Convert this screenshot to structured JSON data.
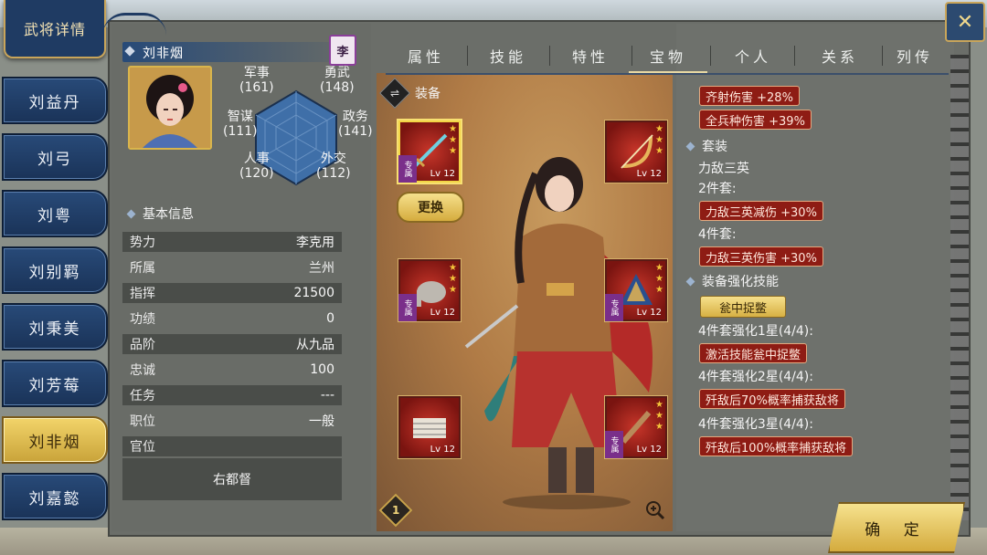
{
  "title": "武将详情",
  "characters": [
    "刘益丹",
    "刘弓",
    "刘粤",
    "刘别羁",
    "刘秉美",
    "刘芳莓",
    "刘非烟",
    "刘嘉懿"
  ],
  "active_character_index": 6,
  "profile": {
    "name": "刘非烟",
    "faction_badge": "李",
    "stats": [
      {
        "label": "军事",
        "value": "(161)"
      },
      {
        "label": "勇武",
        "value": "(148)"
      },
      {
        "label": "智谋",
        "value": "(111)"
      },
      {
        "label": "政务",
        "value": "(141)"
      },
      {
        "label": "人事",
        "value": "(120)"
      },
      {
        "label": "外交",
        "value": "(112)"
      }
    ]
  },
  "basic_info": {
    "header": "基本信息",
    "rows": [
      {
        "k": "势力",
        "v": "李克用"
      },
      {
        "k": "所属",
        "v": "兰州"
      },
      {
        "k": "指挥",
        "v": "21500"
      },
      {
        "k": "功绩",
        "v": "0"
      },
      {
        "k": "品阶",
        "v": "从九品"
      },
      {
        "k": "忠诚",
        "v": "100"
      },
      {
        "k": "任务",
        "v": "---"
      },
      {
        "k": "职位",
        "v": "一般"
      },
      {
        "k": "官位",
        "v": ""
      }
    ],
    "official_title": "右都督"
  },
  "tabs": [
    "属性",
    "技能",
    "特性",
    "宝物",
    "个人",
    "关系",
    "列传"
  ],
  "active_tab_index": 3,
  "equipment": {
    "header": "装备",
    "replace_label": "更换",
    "count": "1",
    "slots": [
      {
        "name": "sword",
        "lv": "Lv 12",
        "stars": 3,
        "exclusive_label": "专属",
        "selected": true
      },
      {
        "name": "bow",
        "lv": "Lv 12",
        "stars": 3,
        "exclusive_label": "",
        "selected": false
      },
      {
        "name": "elephant",
        "lv": "Lv 12",
        "stars": 3,
        "exclusive_label": "专属",
        "selected": false
      },
      {
        "name": "cloak",
        "lv": "Lv 12",
        "stars": 3,
        "exclusive_label": "专属",
        "selected": false
      },
      {
        "name": "book",
        "lv": "Lv 12",
        "stars": 0,
        "exclusive_label": "",
        "selected": false
      },
      {
        "name": "pipe",
        "lv": "Lv 12",
        "stars": 3,
        "exclusive_label": "专属",
        "selected": false
      }
    ]
  },
  "effects": {
    "bonuses": [
      "齐射伤害 +28%",
      "全兵种伤害 +39%"
    ],
    "set_header": "套装",
    "set_name": "力敌三英",
    "set2_label": "2件套:",
    "set2_bonus": "力敌三英减伤 +30%",
    "set4_label": "4件套:",
    "set4_bonus": "力敌三英伤害 +30%",
    "enhance_header": "装备强化技能",
    "enhance_skill": "瓮中捉鳖",
    "star1_label": "4件套强化1星(4/4):",
    "star1_bonus": "激活技能瓮中捉鳖",
    "star2_label": "4件套强化2星(4/4):",
    "star2_bonus": "歼敌后70%概率捕获敌将",
    "star3_label": "4件套强化3星(4/4):",
    "star3_bonus": "歼敌后100%概率捕获敌将"
  },
  "confirm_label": "确 定",
  "colors": {
    "navy": "#1f3b63",
    "gold": "#d5ac3e",
    "red_pill": "#8e1c14",
    "panel": "#6b6e69"
  },
  "icons": [
    "close-icon",
    "swap-icon",
    "zoom-icon",
    "diamond-icon"
  ]
}
